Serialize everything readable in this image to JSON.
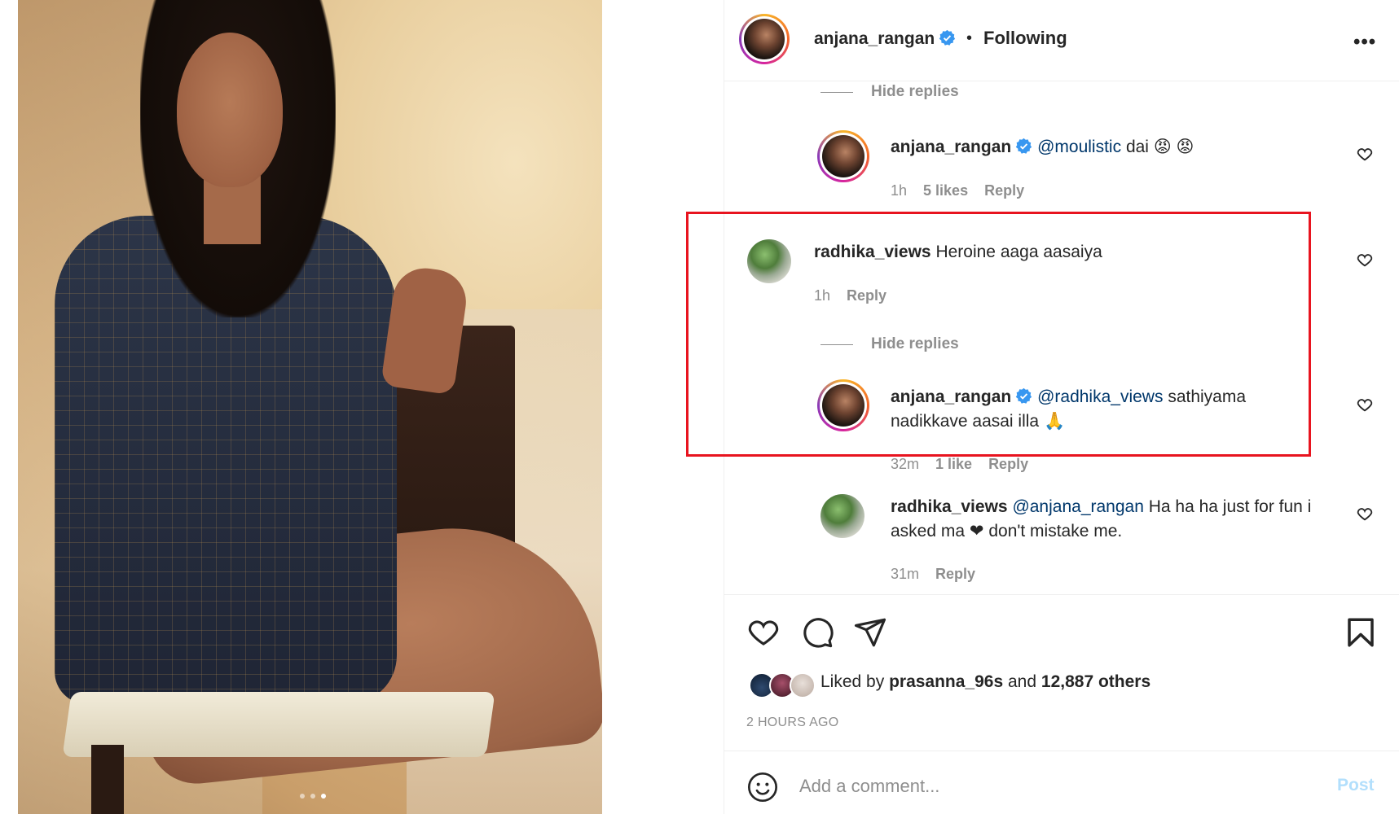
{
  "post": {
    "author": "anjana_rangan",
    "follow_status": "Following",
    "separator": "•",
    "more_label": "•••",
    "carousel": {
      "count": 3,
      "active": 3
    }
  },
  "comments": [
    {
      "type": "hide_replies",
      "label": "Hide replies"
    },
    {
      "type": "reply",
      "username": "anjana_rangan",
      "verified": true,
      "mention": "@moulistic",
      "text": "dai",
      "emoji": "😡 😡",
      "time": "1h",
      "likes": "5 likes",
      "reply_label": "Reply"
    },
    {
      "type": "comment",
      "username": "radhika_views",
      "text": "Heroine aaga aasaiya",
      "time": "1h",
      "reply_label": "Reply"
    },
    {
      "type": "hide_replies",
      "label": "Hide replies"
    },
    {
      "type": "reply",
      "username": "anjana_rangan",
      "verified": true,
      "mention": "@radhika_views",
      "text_line1": "sathiyama",
      "text_line2": "nadikkave aasai illa",
      "emoji": "🙏",
      "time": "32m",
      "likes": "1 like",
      "reply_label": "Reply"
    },
    {
      "type": "reply",
      "username": "radhika_views",
      "mention": "@anjana_rangan",
      "text_line1": "Ha ha ha just for fun i",
      "text_line2a": "asked ma",
      "heart": "❤",
      "text_line2b": "don't mistake me.",
      "time": "31m",
      "reply_label": "Reply"
    }
  ],
  "actions": {
    "liked_prefix": "Liked by",
    "liked_user": "prasanna_96s",
    "liked_and": "and",
    "liked_others": "12,887 others",
    "time_ago": "2 HOURS AGO"
  },
  "composer": {
    "placeholder": "Add a comment...",
    "post_label": "Post"
  },
  "colors": {
    "highlight_box": "#e8141f",
    "mention": "#00376b",
    "verified": "#3897f0",
    "muted": "#8e8e8e",
    "post_disabled": "#b2dffc"
  }
}
